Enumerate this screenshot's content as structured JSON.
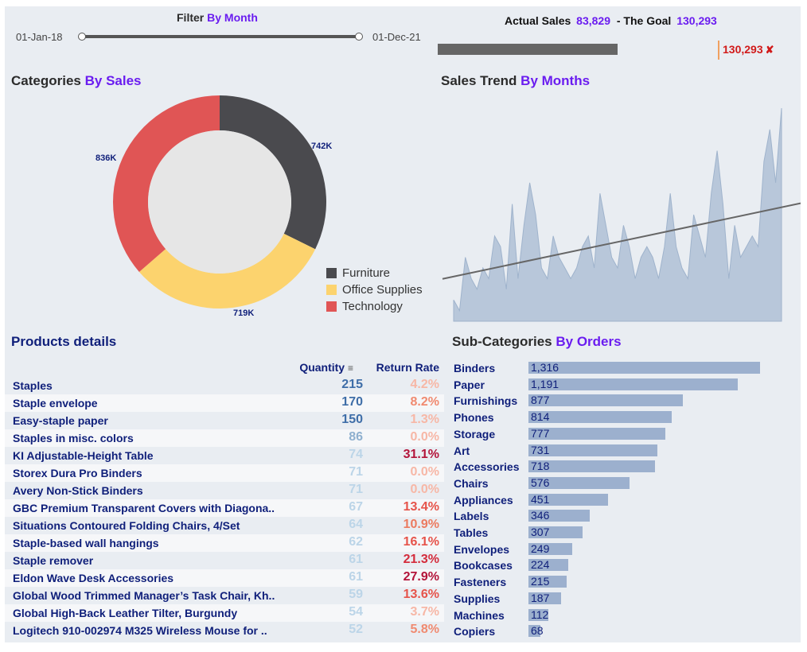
{
  "filter": {
    "title_prefix": "Filter",
    "title_highlight": "By Month",
    "start_date": "01-Jan-18",
    "end_date": "01-Dec-21"
  },
  "goal": {
    "actual_label": "Actual Sales",
    "actual_value": "83,829",
    "goal_label": "- The Goal",
    "goal_value": "130,293",
    "marker_value": "130,293",
    "marker_icon": "x-icon",
    "actual_fraction": 0.643
  },
  "categories": {
    "title_prefix": "Categories",
    "title_highlight": "By Sales",
    "slices": [
      {
        "name": "Furniture",
        "value": 742,
        "label": "742K",
        "color": "#4a4a4e"
      },
      {
        "name": "Office Supplies",
        "value": 719,
        "label": "719K",
        "color": "#fcd36e"
      },
      {
        "name": "Technology",
        "value": 836,
        "label": "836K",
        "color": "#e05555"
      }
    ]
  },
  "trend": {
    "title_prefix": "Sales Trend",
    "title_highlight": "By Months",
    "chart_data": {
      "type": "area",
      "values": [
        2,
        1,
        6,
        4,
        3,
        5,
        4,
        8,
        7,
        3,
        11,
        4,
        9,
        13,
        10,
        5,
        4,
        8,
        6,
        5,
        4,
        5,
        7,
        8,
        5,
        12,
        9,
        6,
        5,
        9,
        7,
        4,
        6,
        7,
        6,
        4,
        7,
        12,
        7,
        5,
        4,
        10,
        8,
        6,
        12,
        16,
        11,
        4,
        9,
        6,
        7,
        8,
        7,
        15,
        18,
        13,
        20
      ]
    }
  },
  "products": {
    "title": "Products details",
    "col_quantity": "Quantity",
    "col_return": "Return Rate",
    "rows": [
      {
        "name": "Staples",
        "qty": "215",
        "rate": "4.2%"
      },
      {
        "name": "Staple envelope",
        "qty": "170",
        "rate": "8.2%"
      },
      {
        "name": "Easy-staple paper",
        "qty": "150",
        "rate": "1.3%"
      },
      {
        "name": "Staples in misc. colors",
        "qty": "86",
        "rate": "0.0%"
      },
      {
        "name": "KI Adjustable-Height Table",
        "qty": "74",
        "rate": "31.1%"
      },
      {
        "name": "Storex Dura Pro Binders",
        "qty": "71",
        "rate": "0.0%"
      },
      {
        "name": "Avery Non-Stick Binders",
        "qty": "71",
        "rate": "0.0%"
      },
      {
        "name": "GBC Premium Transparent Covers with Diagona..",
        "qty": "67",
        "rate": "13.4%"
      },
      {
        "name": "Situations Contoured Folding Chairs, 4/Set",
        "qty": "64",
        "rate": "10.9%"
      },
      {
        "name": "Staple-based wall hangings",
        "qty": "62",
        "rate": "16.1%"
      },
      {
        "name": "Staple remover",
        "qty": "61",
        "rate": "21.3%"
      },
      {
        "name": "Eldon Wave Desk Accessories",
        "qty": "61",
        "rate": "27.9%"
      },
      {
        "name": "Global Wood Trimmed Manager’s Task Chair, Kh..",
        "qty": "59",
        "rate": "13.6%"
      },
      {
        "name": "Global High-Back Leather Tilter, Burgundy",
        "qty": "54",
        "rate": "3.7%"
      },
      {
        "name": "Logitech 910-002974 M325 Wireless Mouse for ..",
        "qty": "52",
        "rate": "5.8%"
      }
    ]
  },
  "subcategories": {
    "title_prefix": "Sub-Categories",
    "title_highlight": "By Orders",
    "rows": [
      {
        "name": "Binders",
        "value": 1316,
        "label": "1,316"
      },
      {
        "name": "Paper",
        "value": 1191,
        "label": "1,191"
      },
      {
        "name": "Furnishings",
        "value": 877,
        "label": "877"
      },
      {
        "name": "Phones",
        "value": 814,
        "label": "814"
      },
      {
        "name": "Storage",
        "value": 777,
        "label": "777"
      },
      {
        "name": "Art",
        "value": 731,
        "label": "731"
      },
      {
        "name": "Accessories",
        "value": 718,
        "label": "718"
      },
      {
        "name": "Chairs",
        "value": 576,
        "label": "576"
      },
      {
        "name": "Appliances",
        "value": 451,
        "label": "451"
      },
      {
        "name": "Labels",
        "value": 346,
        "label": "346"
      },
      {
        "name": "Tables",
        "value": 307,
        "label": "307"
      },
      {
        "name": "Envelopes",
        "value": 249,
        "label": "249"
      },
      {
        "name": "Bookcases",
        "value": 224,
        "label": "224"
      },
      {
        "name": "Fasteners",
        "value": 215,
        "label": "215"
      },
      {
        "name": "Supplies",
        "value": 187,
        "label": "187"
      },
      {
        "name": "Machines",
        "value": 112,
        "label": "112"
      },
      {
        "name": "Copiers",
        "value": 68,
        "label": "68"
      }
    ]
  }
}
